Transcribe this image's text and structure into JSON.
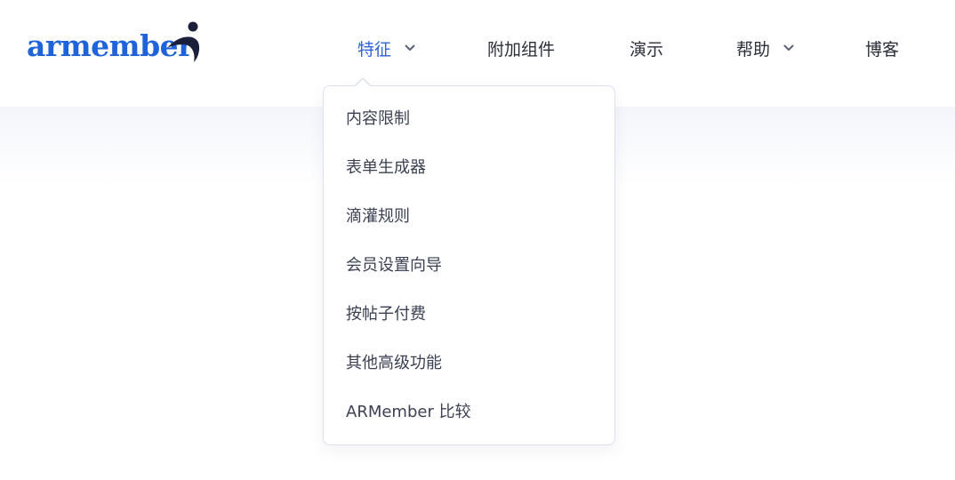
{
  "logo": {
    "text": "armember",
    "brand_color": "#1e63d9",
    "mark_color": "#1a1f3a"
  },
  "nav": {
    "items": [
      {
        "label": "特征",
        "has_dropdown": true,
        "active": true
      },
      {
        "label": "附加组件",
        "has_dropdown": false
      },
      {
        "label": "演示",
        "has_dropdown": false
      },
      {
        "label": "帮助",
        "has_dropdown": true
      },
      {
        "label": "博客",
        "has_dropdown": false
      }
    ],
    "active_color": "#2f64d8",
    "text_color": "#2b2d3a"
  },
  "dropdown": {
    "items": [
      {
        "label": "内容限制"
      },
      {
        "label": "表单生成器"
      },
      {
        "label": "滴灌规则"
      },
      {
        "label": "会员设置向导"
      },
      {
        "label": "按帖子付费"
      },
      {
        "label": "其他高级功能"
      },
      {
        "label": "ARMember 比较"
      }
    ]
  },
  "icons": {
    "chevron": "chevron-down-icon"
  }
}
